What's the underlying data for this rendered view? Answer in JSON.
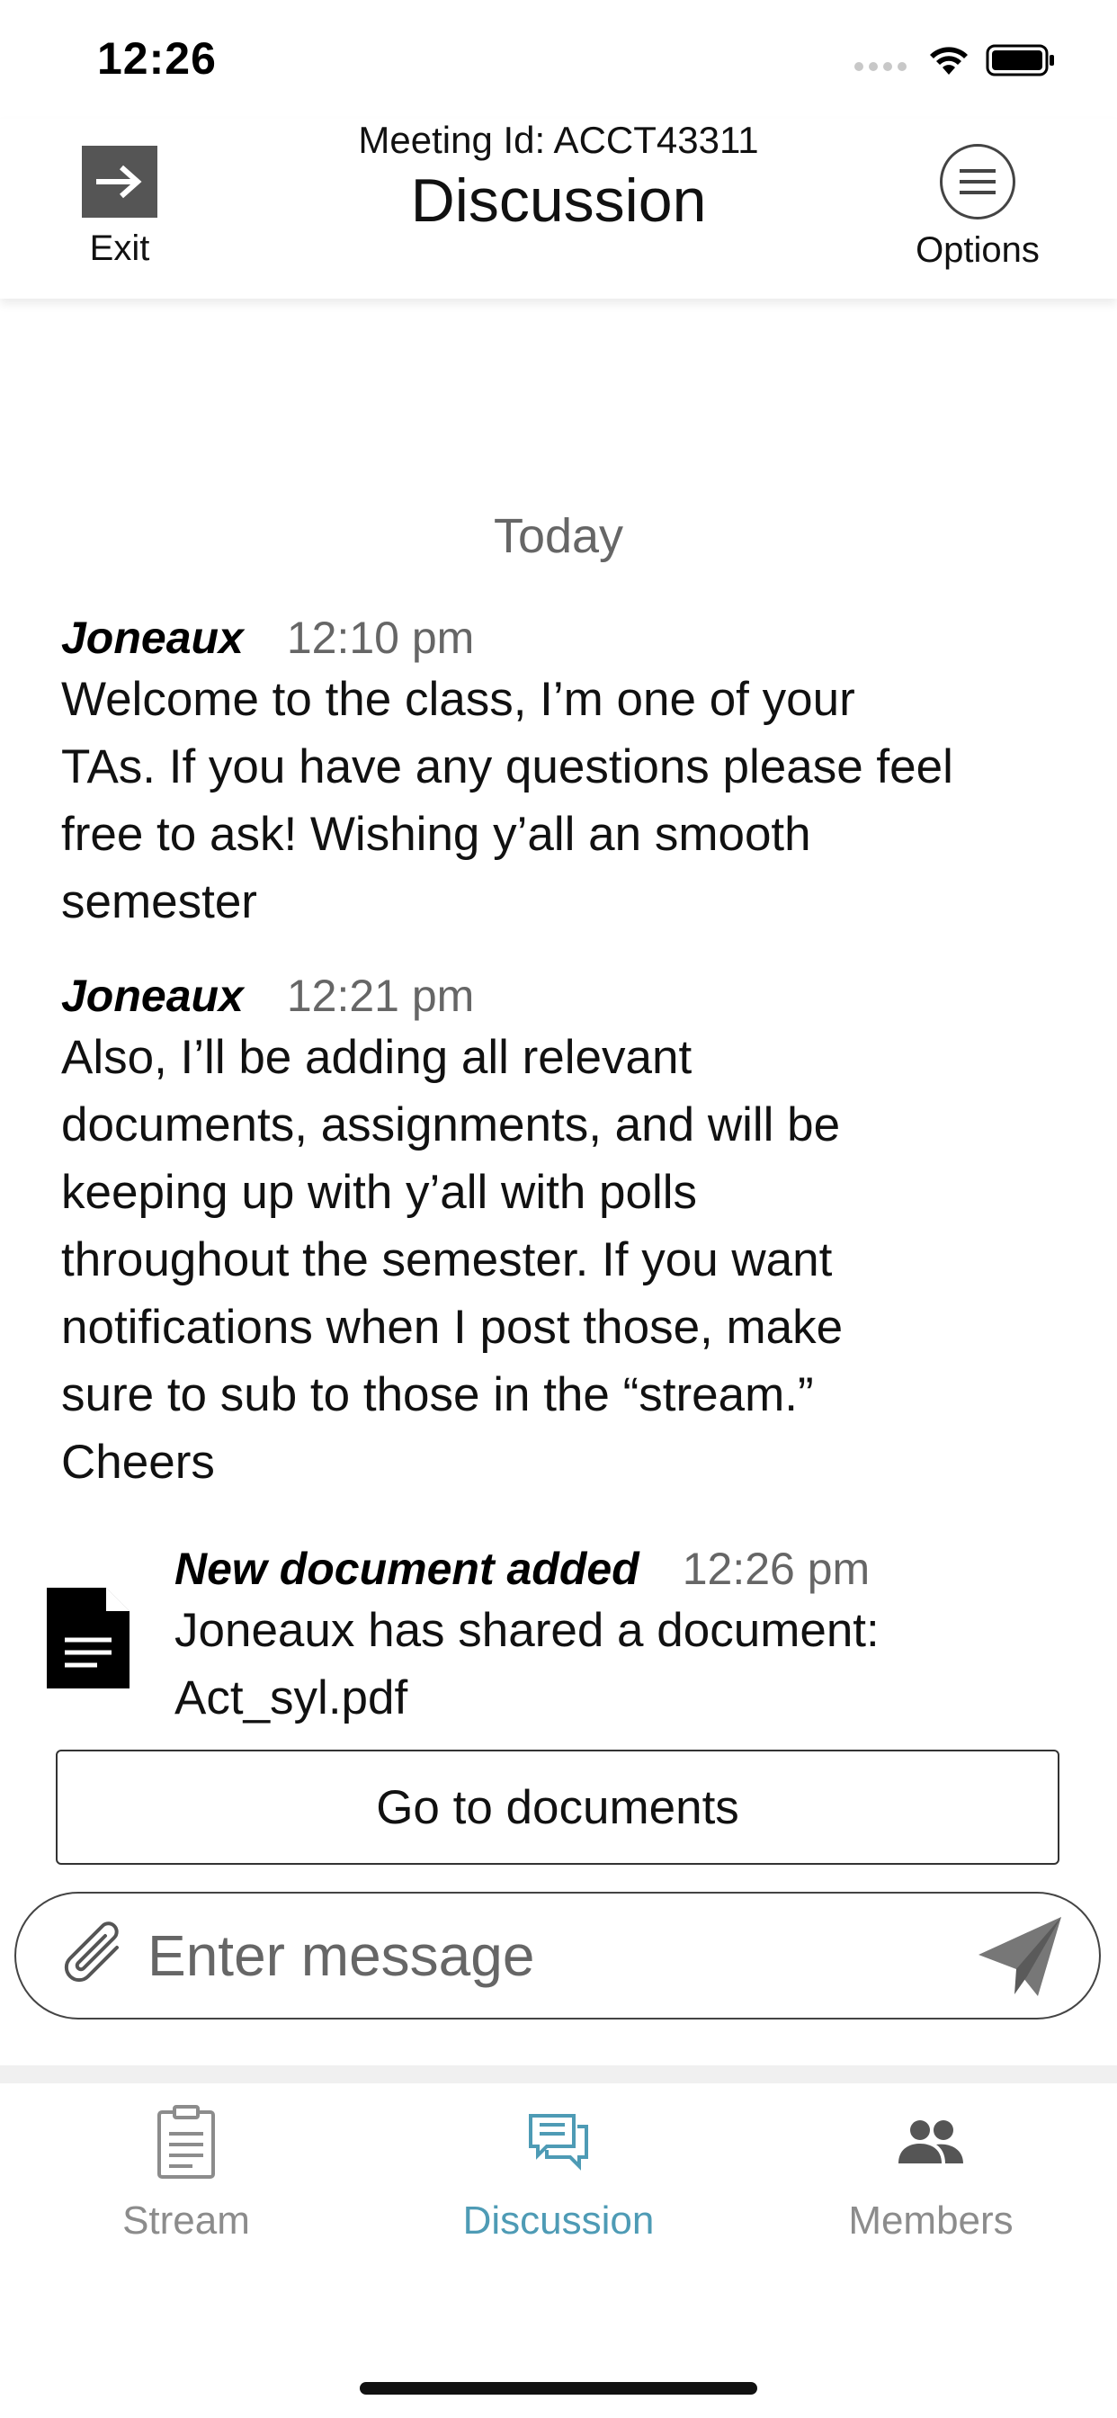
{
  "status_bar": {
    "time": "12:26"
  },
  "header": {
    "exit_label": "Exit",
    "meeting_id": "Meeting Id: ACCT43311",
    "title": "Discussion",
    "options_label": "Options"
  },
  "chat": {
    "date_divider": "Today",
    "messages": [
      {
        "author": "Joneaux",
        "time": "12:10 pm",
        "lines": [
          "Welcome to the class, I’m one of your",
          "TAs. If you have any questions please feel",
          "free to ask! Wishing y’all an smooth",
          "semester"
        ]
      },
      {
        "author": "Joneaux",
        "time": "12:21 pm",
        "lines": [
          "Also, I’ll be adding all relevant",
          "documents, assignments, and will be",
          "keeping up with y’all with polls",
          "throughout the semester. If you want",
          "notifications when I post those, make",
          "sure to sub to those in the “stream.”",
          "Cheers"
        ]
      }
    ],
    "document_notice": {
      "title": "New document added",
      "time": "12:26 pm",
      "lines": [
        "Joneaux has shared a document:",
        "Act_syl.pdf"
      ],
      "icon": "document-icon"
    },
    "go_to_documents_label": "Go to documents"
  },
  "composer": {
    "placeholder": "Enter message",
    "attach_icon": "paperclip-icon",
    "send_icon": "send-icon"
  },
  "tabs": [
    {
      "label": "Stream",
      "icon": "clipboard-icon",
      "active": false
    },
    {
      "label": "Discussion",
      "icon": "chat-icon",
      "active": true
    },
    {
      "label": "Members",
      "icon": "people-icon",
      "active": false
    }
  ],
  "colors": {
    "active_tab": "#4e9bb5",
    "inactive_tab": "#8c8c8c",
    "exit_box": "#555555"
  }
}
